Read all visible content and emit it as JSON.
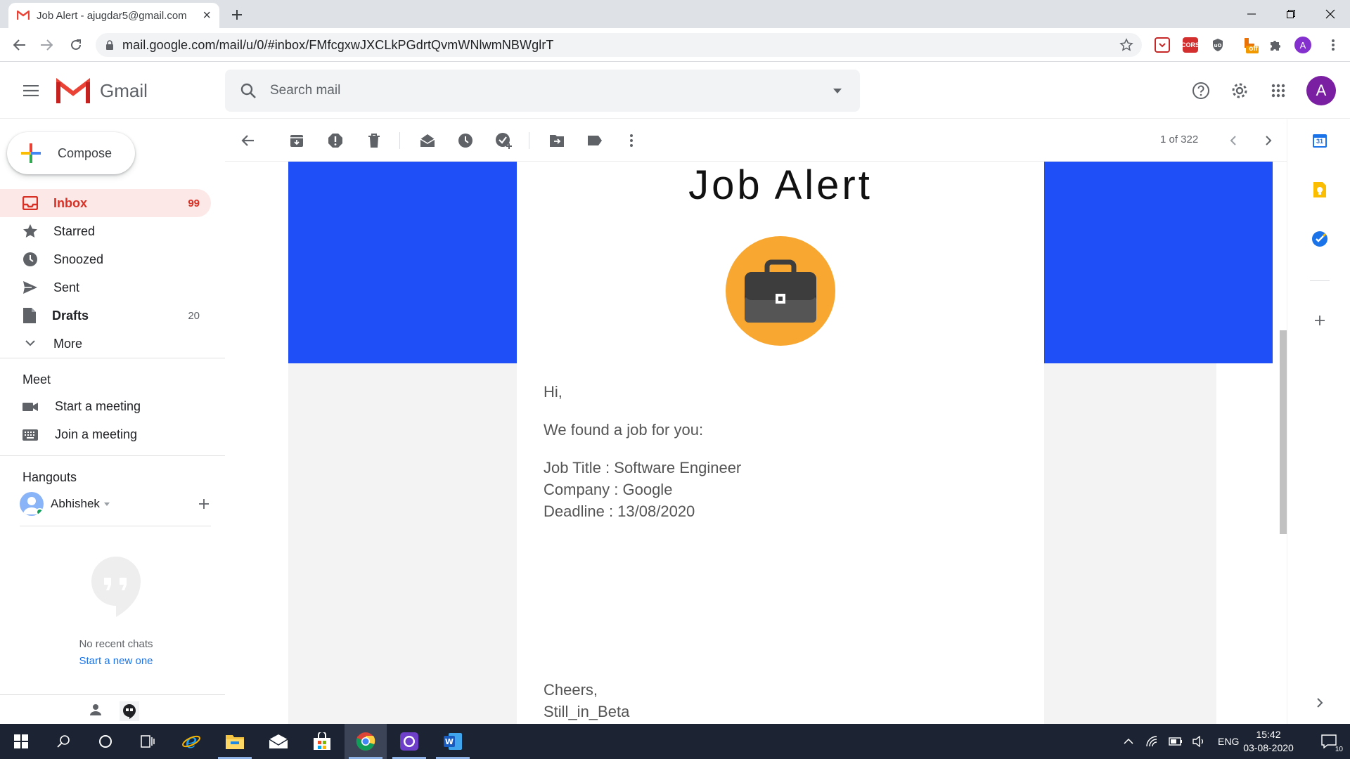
{
  "browser": {
    "tab_title": "Job Alert - ajugdar5@gmail.com",
    "url": "mail.google.com/mail/u/0/#inbox/FMfcgxwJXCLkPGdrtQvmWNlwmNBWglrT",
    "profile_initial": "A",
    "ext_badge": "off",
    "ext_cors": "CORS"
  },
  "gmail": {
    "product_name": "Gmail",
    "search_placeholder": "Search mail",
    "avatar_initial": "A"
  },
  "sidebar": {
    "compose_label": "Compose",
    "items": [
      {
        "label": "Inbox",
        "count": "99"
      },
      {
        "label": "Starred",
        "count": ""
      },
      {
        "label": "Snoozed",
        "count": ""
      },
      {
        "label": "Sent",
        "count": ""
      },
      {
        "label": "Drafts",
        "count": "20"
      },
      {
        "label": "More",
        "count": ""
      }
    ],
    "meet": {
      "title": "Meet",
      "start": "Start a meeting",
      "join": "Join a meeting"
    },
    "hangouts": {
      "title": "Hangouts",
      "user": "Abhishek",
      "no_chats": "No recent chats",
      "start_new": "Start a new one"
    }
  },
  "toolbar": {
    "pager": "1 of 322"
  },
  "email": {
    "heading": "Job Alert",
    "greeting": "Hi,",
    "intro": "We found a job for you:",
    "job_title": "Job Title : Software Engineer",
    "company": "Company : Google",
    "deadline": "Deadline : 13/08/2020",
    "signoff": "Cheers,",
    "signature": "Still_in_Beta",
    "colors": {
      "banner": "#1f4ff7",
      "badge": "#f8a731",
      "briefcase": "#3d3d3d"
    }
  },
  "sidepanel": {
    "calendar_day": "31"
  },
  "taskbar": {
    "language": "ENG",
    "time": "15:42",
    "date": "03-08-2020",
    "notifications": "10"
  }
}
